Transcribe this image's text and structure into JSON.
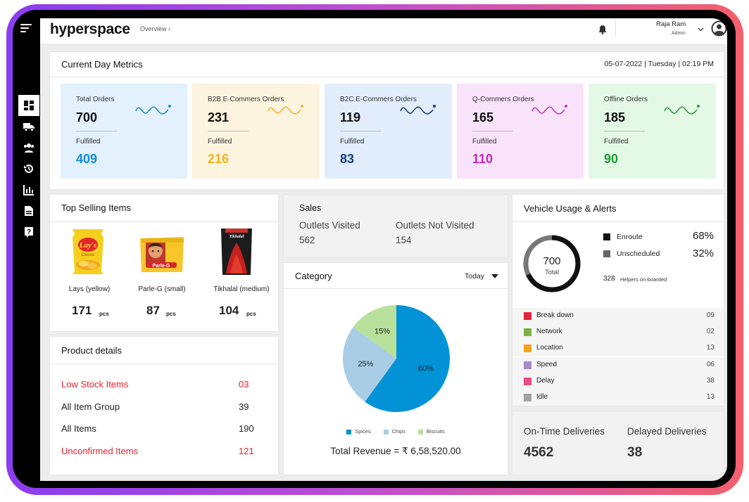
{
  "app": {
    "brand": "hyperspace",
    "breadcrumb": "Overview ›"
  },
  "user": {
    "name": "Raja Ram",
    "role": "Admin"
  },
  "sidebar": {
    "icons": [
      "dashboard-icon",
      "truck-icon",
      "users-icon",
      "history-icon",
      "bar-chart-icon",
      "report-icon",
      "help-icon"
    ]
  },
  "metrics": {
    "title": "Current Day Metrics",
    "datetime": "05-07-2022 | Tuesday | 02:19 PM",
    "fulfilled_label": "Fulfilled",
    "cards": [
      {
        "label": "Total Orders",
        "value": "700",
        "fulfilled": "409",
        "bg": "#e3f1fc",
        "accent": "#0c8fd1",
        "wave": "#1a8fcf"
      },
      {
        "label": "B2B E-Commers Orders",
        "value": "231",
        "fulfilled": "216",
        "bg": "#fdf4df",
        "accent": "#f4b31b",
        "wave": "#f0b22a"
      },
      {
        "label": "B2C E-Commers Orders",
        "value": "119",
        "fulfilled": "83",
        "bg": "#e1edfb",
        "accent": "#0f3c7b",
        "wave": "#15386e"
      },
      {
        "label": "Q-Commers Orders",
        "value": "165",
        "fulfilled": "110",
        "bg": "#f9e3fa",
        "accent": "#c426c0",
        "wave": "#c12fbd"
      },
      {
        "label": "Offline Orders",
        "value": "185",
        "fulfilled": "90",
        "bg": "#e4f8e6",
        "accent": "#1f9a35",
        "wave": "#2d9a3c"
      }
    ]
  },
  "top_selling": {
    "title": "Top Selling Items",
    "unit": "pcs",
    "items": [
      {
        "name": "Lays (yellow)",
        "qty": "171",
        "logo": "Lay's",
        "sub": "Classic"
      },
      {
        "name": "Parle-G (small)",
        "qty": "87",
        "logo": "Parle-G"
      },
      {
        "name": "Tikhalal (medium)",
        "qty": "104",
        "logo": "Tikhalal"
      }
    ]
  },
  "product_details": {
    "title": "Product details",
    "rows": [
      {
        "label": "Low Stock Items",
        "value": "03",
        "alert": true
      },
      {
        "label": "All Item Group",
        "value": "39",
        "alert": false
      },
      {
        "label": "All Items",
        "value": "190",
        "alert": false
      },
      {
        "label": "Unconfirmed Items",
        "value": "121",
        "alert": true
      }
    ]
  },
  "sales": {
    "title": "Sales",
    "visited_label": "Outlets Visited",
    "visited": "562",
    "not_visited_label": "Outlets Not Visited",
    "not_visited": "154"
  },
  "category": {
    "title": "Category",
    "filter": "Today",
    "total_revenue": "Total Revenue = ₹ 6,58,520.00"
  },
  "chart_data": {
    "type": "pie",
    "categories": [
      "Spices",
      "Chips",
      "Biscuits"
    ],
    "values": [
      60,
      25,
      15
    ],
    "labels": [
      "60%",
      "25%",
      "15%"
    ],
    "colors": [
      "#0292d6",
      "#a9cde5",
      "#b7e09a"
    ],
    "legend": "bottom"
  },
  "vehicle": {
    "title": "Vehicle Usage & Alerts",
    "total": "700",
    "total_label": "Total",
    "enroute_fraction": 0.68,
    "enroute_label": "Enroute",
    "enroute_pct": "68%",
    "unsched_label": "Unscheduled",
    "unsched_pct": "32%",
    "helpers_count": "328",
    "helpers_label": "Helpers on-boarded",
    "alerts": [
      {
        "name": "Break down",
        "count": "09",
        "color": "#e4263a"
      },
      {
        "name": "Network",
        "count": "02",
        "color": "#7bb245"
      },
      {
        "name": "Location",
        "count": "13",
        "color": "#f7a21c"
      },
      {
        "name": "Speed",
        "count": "06",
        "color": "#a98ac7"
      },
      {
        "name": "Delay",
        "count": "38",
        "color": "#ee4a86"
      },
      {
        "name": "Idle",
        "count": "13",
        "color": "#a3a3a3"
      }
    ]
  },
  "deliveries": {
    "ontime_label": "On-Time Deliveries",
    "ontime": "4562",
    "delayed_label": "Delayed Deliveries",
    "delayed": "38"
  }
}
